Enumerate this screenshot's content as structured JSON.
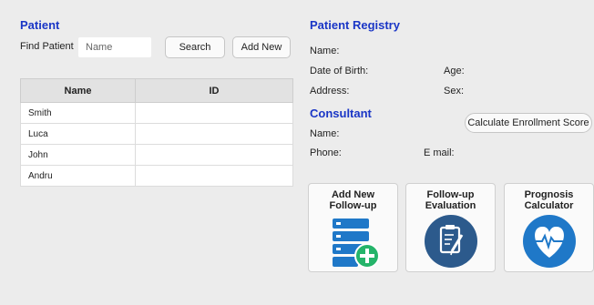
{
  "patient": {
    "title": "Patient",
    "find_label": "Find Patient",
    "search_placeholder": "Name",
    "search_label": "Search",
    "add_new_label": "Add New",
    "table": {
      "headers": [
        "Name",
        "ID"
      ],
      "rows": [
        {
          "name": "Smith",
          "id": ""
        },
        {
          "name": "Luca",
          "id": ""
        },
        {
          "name": "John",
          "id": ""
        },
        {
          "name": "Andru",
          "id": ""
        }
      ]
    }
  },
  "registry": {
    "title": "Patient Registry",
    "name_label": "Name:",
    "dob_label": "Date of Birth:",
    "age_label": "Age:",
    "address_label": "Address:",
    "sex_label": "Sex:"
  },
  "consultant": {
    "title": "Consultant",
    "calc_button": "Calculate Enrollment Score",
    "name_label": "Name:",
    "phone_label": "Phone:",
    "email_label": "E mail:"
  },
  "tiles": [
    {
      "line1": "Add New",
      "line2": "Follow-up",
      "icon": "database-add-icon"
    },
    {
      "line1": "Follow-up",
      "line2": "Evaluation",
      "icon": "clipboard-pen-icon"
    },
    {
      "line1": "Prognosis",
      "line2": "Calculator",
      "icon": "heart-pulse-icon"
    }
  ],
  "colors": {
    "accent": "#1a36c6",
    "icon_blue": "#1f78c8",
    "icon_dark": "#2c5a8c",
    "plus_green": "#25b46a"
  }
}
